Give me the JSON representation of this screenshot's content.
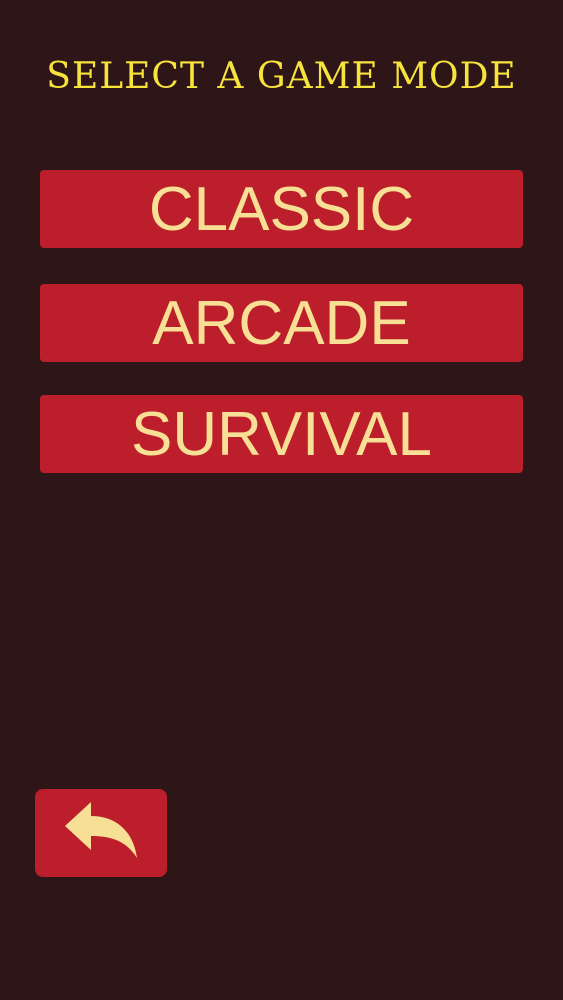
{
  "header": {
    "title": "SELECT A GAME MODE"
  },
  "modes": [
    {
      "label": "CLASSIC"
    },
    {
      "label": "ARCADE"
    },
    {
      "label": "SURVIVAL"
    }
  ],
  "back_button": {
    "icon": "back-arrow-icon"
  },
  "colors": {
    "background": "#2e1517",
    "title_text": "#f6e33c",
    "button_fill": "#bc1f2b",
    "button_text": "#f7df95"
  }
}
